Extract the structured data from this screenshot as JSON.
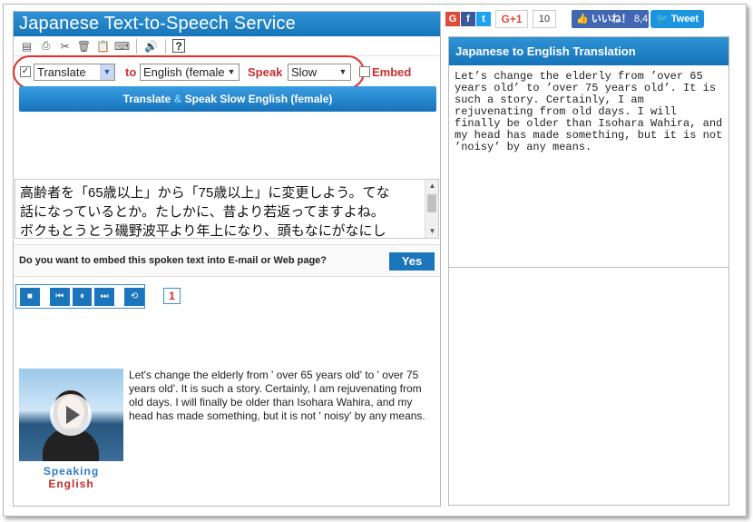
{
  "header": {
    "title": "Japanese Text-to-Speech Service"
  },
  "toolbar": {
    "icons": [
      "notepad-icon",
      "print-icon",
      "cut-icon",
      "trash-icon",
      "paste-icon",
      "keyboard-icon",
      "speaker-icon",
      "help-icon"
    ],
    "help_glyph": "?"
  },
  "controls": {
    "translate_checked": true,
    "translate_select": "Translate",
    "to_label": "to",
    "language_select": "English (female",
    "speak_label": "Speak",
    "speed_select": "Slow",
    "embed_label": "Embed"
  },
  "main_button": {
    "part1": "Translate",
    "amp": " & ",
    "part2": "Speak Slow English (female)"
  },
  "japanese_text": {
    "line1": "高齢者を「65歳以上」から「75歳以上」に変更しよう。てな",
    "line2": "話になっているとか。たしかに、昔より若返ってますよね。",
    "line3": "ボクもとうとう磯野波平より年上になり、頭もなにがなにし"
  },
  "embed": {
    "question": "Do you want to embed this spoken text into E-mail or Web page?",
    "yes": "Yes"
  },
  "player": {
    "stop": "■",
    "prev": "⏮",
    "pause": "⏸",
    "next": "⏭",
    "repeat": "⟲",
    "counter": "1"
  },
  "avatar": {
    "speaking": "Speaking",
    "language": "English"
  },
  "english_result": "Let's change the elderly from ' over 65 years old' to ' over 75 years old'. It is such a story. Certainly, I am rejuvenating from old days. I will finally be older than Isohara Wahira, and my head has made something, but it is not ' noisy' by any means.",
  "social": {
    "google": "G",
    "facebook": "f",
    "twitter": "t",
    "gplus": "G+1",
    "gcount": "10",
    "like": "いいね！",
    "like_count": "8,4",
    "tweet": "Tweet"
  },
  "translation_panel": {
    "title": "Japanese to English Translation",
    "text": "Let’s change the elderly from ’over 65 years old’ to ’over 75 years old’. It is such a story. Certainly, I am rejuvenating from old days. I will finally be older than Isohara Wahira, and my head has made something, but it is not ’noisy’ by any means."
  },
  "colors": {
    "brand_blue": "#1b75bb",
    "accent_red": "#c93033",
    "header_gradient_top": "#2f93d6"
  }
}
